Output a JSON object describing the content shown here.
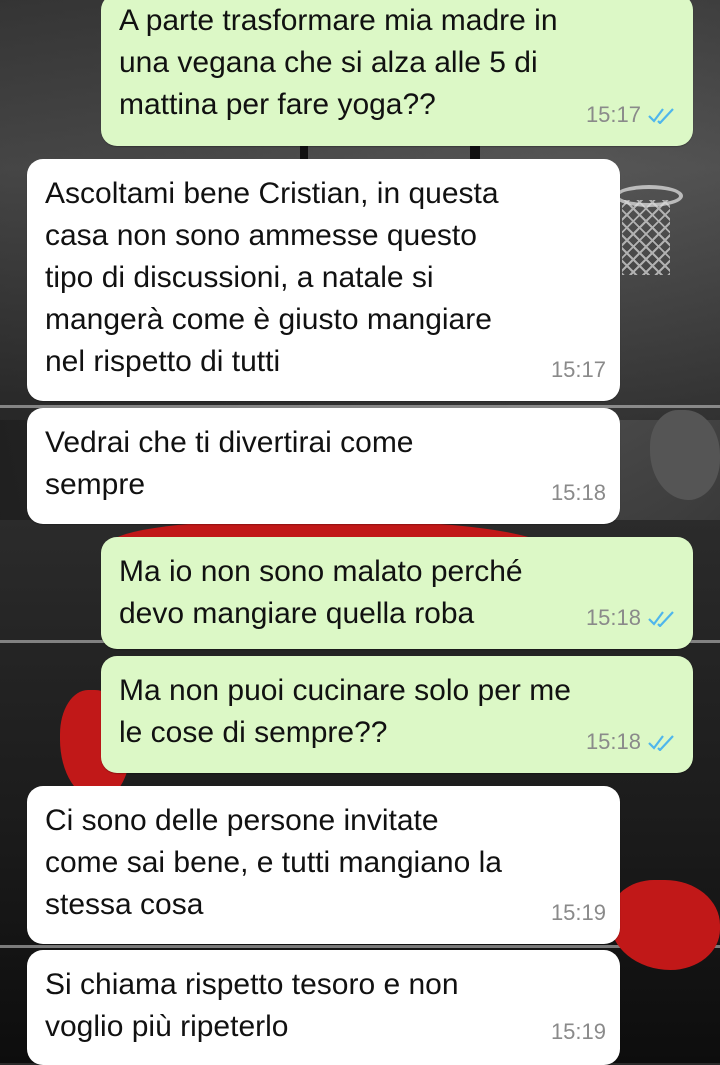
{
  "colors": {
    "outgoing_bubble": "#dcf8c6",
    "incoming_bubble": "#ffffff",
    "read_ticks": "#4fb6ec",
    "timestamp": "#8a8a8a"
  },
  "messages": [
    {
      "direction": "outgoing",
      "text": "A parte trasformare mia madre in\nuna vegana che si alza alle 5 di\nmattina per fare yoga??",
      "time": "15:17",
      "status_icon": "double-check-read-icon"
    },
    {
      "direction": "incoming",
      "text": "Ascoltami bene Cristian, in questa\ncasa non sono ammesse questo\ntipo di discussioni, a natale si\nmangerà come è giusto mangiare\nnel rispetto di tutti",
      "time": "15:17"
    },
    {
      "direction": "incoming",
      "text": "Vedrai che ti divertirai come\nsempre",
      "time": "15:18"
    },
    {
      "direction": "outgoing",
      "text": "Ma io non sono malato perché\ndevo mangiare quella roba",
      "time": "15:18",
      "status_icon": "double-check-read-icon"
    },
    {
      "direction": "outgoing",
      "text": "Ma non puoi cucinare solo per me\nle cose di sempre??",
      "time": "15:18",
      "status_icon": "double-check-read-icon"
    },
    {
      "direction": "incoming",
      "text": "Ci sono delle persone invitate\ncome sai bene, e tutti mangiano la\nstessa cosa",
      "time": "15:19"
    },
    {
      "direction": "incoming",
      "text": "Si chiama rispetto tesoro e non\nvoglio più ripeterlo",
      "time": "15:19"
    }
  ]
}
